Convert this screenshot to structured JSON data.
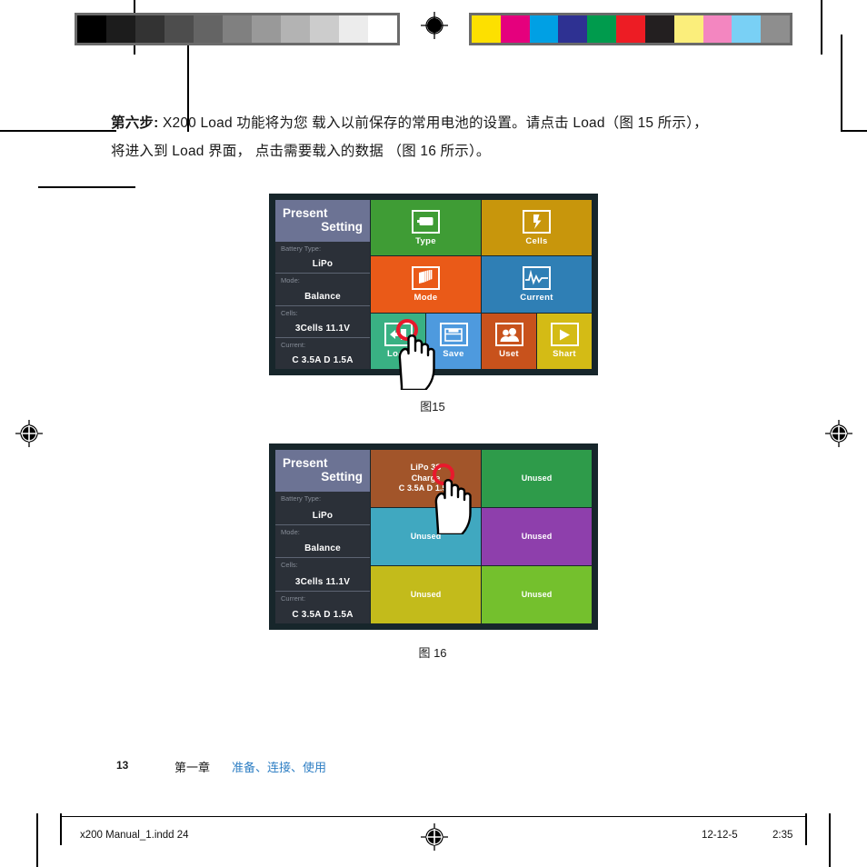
{
  "document": {
    "body_paragraph_line1_prefix": "第六步:",
    "body_paragraph_line1": " X200 Load 功能将为您 载入以前保存的常用电池的设置。请点击 Load（图 15 所示），",
    "body_paragraph_line2": "将进入到 Load 界面， 点击需要载入的数据 （图 16 所示）。"
  },
  "figure15": {
    "caption": "图15",
    "sidebar": {
      "title_line1": "Present",
      "title_line2": "Setting",
      "rows": [
        {
          "key": "Battery Type:",
          "value": "LiPo"
        },
        {
          "key": "Mode:",
          "value": "Balance"
        },
        {
          "key": "Cells:",
          "value": "3Cells  11.1V"
        },
        {
          "key": "Current:",
          "value": "C 3.5A  D 1.5A"
        }
      ]
    },
    "tiles_row1": [
      {
        "label": "Type",
        "icon": "battery-icon",
        "color": "#3f9c35"
      },
      {
        "label": "Cells",
        "icon": "lightning-bolt-icon",
        "color": "#c8960c"
      }
    ],
    "tiles_row2": [
      {
        "label": "Mode",
        "icon": "books-stack-icon",
        "color": "#ea5a18"
      },
      {
        "label": "Current",
        "icon": "waveform-icon",
        "color": "#2f7fb5"
      }
    ],
    "tiles_row3": [
      {
        "label": "Load",
        "icon": "load-arrow-icon",
        "color": "#39b183"
      },
      {
        "label": "Save",
        "icon": "save-drawer-icon",
        "color": "#4e9ade"
      },
      {
        "label": "Uset",
        "icon": "users-icon",
        "color": "#c8521c"
      },
      {
        "label": "Shart",
        "icon": "play-triangle-icon",
        "color": "#d4bb15"
      }
    ],
    "touch_target": "Load"
  },
  "figure16": {
    "caption": "图 16",
    "sidebar": {
      "title_line1": "Present",
      "title_line2": "Setting",
      "rows": [
        {
          "key": "Battery Type:",
          "value": "LiPo"
        },
        {
          "key": "Mode:",
          "value": "Balance"
        },
        {
          "key": "Cells:",
          "value": "3Cells  11.1V"
        },
        {
          "key": "Current:",
          "value": "C 3.5A  D 1.5A"
        }
      ]
    },
    "slots": [
      {
        "lines": [
          "LiPo 3S",
          "Charge",
          "C 3.5A  D 1.5A"
        ],
        "color": "#a2552a",
        "used": true
      },
      {
        "lines": [
          "Unused"
        ],
        "color": "#2e9b4a",
        "used": false
      },
      {
        "lines": [
          "Unused"
        ],
        "color": "#40a8c0",
        "used": false
      },
      {
        "lines": [
          "Unused"
        ],
        "color": "#8e3fac",
        "used": false
      },
      {
        "lines": [
          "Unused"
        ],
        "color": "#c3bb1b",
        "used": false
      },
      {
        "lines": [
          "Unused"
        ],
        "color": "#74c02d",
        "used": false
      }
    ],
    "touch_target": "LiPo 3S Charge"
  },
  "footer": {
    "page_number": "13",
    "chapter": "第一章",
    "chapter_topics": "准备、连接、使用",
    "file_name": "x200 Manual_1.indd   24",
    "date": "12-12-5",
    "time": "2:35"
  },
  "calibration": {
    "grayscale": [
      "#000000",
      "#1c1c1c",
      "#333333",
      "#4d4d4d",
      "#646464",
      "#808080",
      "#999999",
      "#b3b3b3",
      "#cccccc",
      "#ececec",
      "#ffffff"
    ],
    "colors": [
      "#fde000",
      "#e5007d",
      "#00a0e4",
      "#2e3192",
      "#009b4d",
      "#ed1c24",
      "#231f20",
      "#fbee7b",
      "#f386c0",
      "#79d0f5",
      "#8e8e8e"
    ]
  }
}
